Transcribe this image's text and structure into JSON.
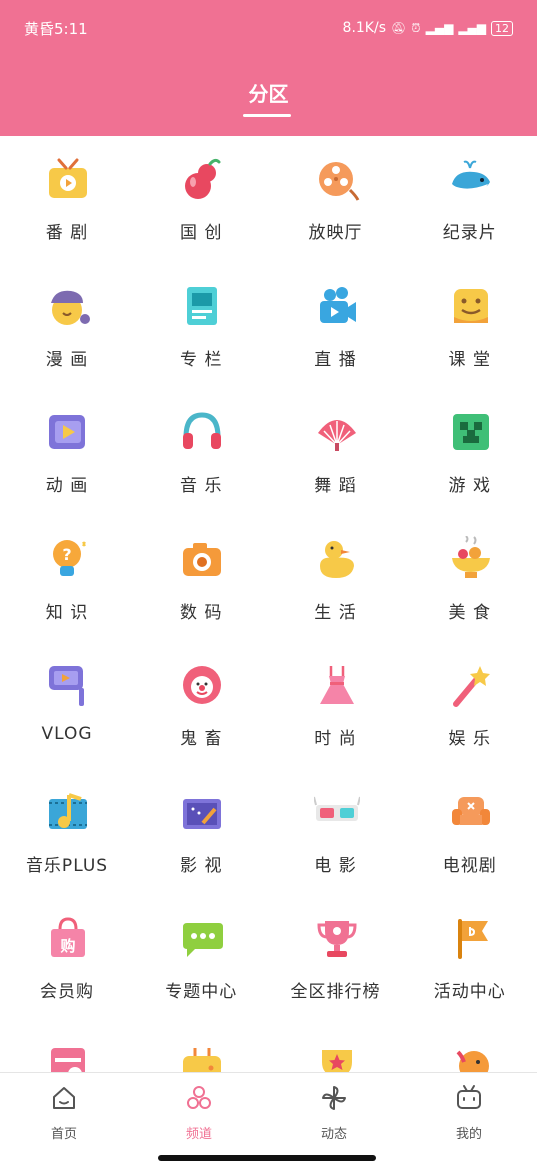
{
  "status_bar": {
    "time": "黄昏5:11",
    "speed": "8.1K/s",
    "battery": "12"
  },
  "header": {
    "title": "分区"
  },
  "categories": [
    {
      "label": "番 剧",
      "icon": "tv-icon"
    },
    {
      "label": "国 创",
      "icon": "gourd-icon"
    },
    {
      "label": "放映厅",
      "icon": "film-reel-icon"
    },
    {
      "label": "纪录片",
      "icon": "whale-icon"
    },
    {
      "label": "漫 画",
      "icon": "beret-character-icon"
    },
    {
      "label": "专 栏",
      "icon": "article-icon"
    },
    {
      "label": "直 播",
      "icon": "video-camera-icon"
    },
    {
      "label": "课 堂",
      "icon": "smiley-card-icon"
    },
    {
      "label": "动 画",
      "icon": "play-square-icon"
    },
    {
      "label": "音 乐",
      "icon": "headphones-icon"
    },
    {
      "label": "舞 蹈",
      "icon": "fan-icon"
    },
    {
      "label": "游 戏",
      "icon": "creeper-icon"
    },
    {
      "label": "知 识",
      "icon": "lightbulb-question-icon"
    },
    {
      "label": "数 码",
      "icon": "camera-icon"
    },
    {
      "label": "生 活",
      "icon": "duck-icon"
    },
    {
      "label": "美 食",
      "icon": "food-bowl-icon"
    },
    {
      "label": "VLOG",
      "icon": "selfie-stick-icon"
    },
    {
      "label": "鬼 畜",
      "icon": "clown-icon"
    },
    {
      "label": "时 尚",
      "icon": "dress-icon"
    },
    {
      "label": "娱 乐",
      "icon": "magic-wand-icon"
    },
    {
      "label": "音乐PLUS",
      "icon": "music-note-icon"
    },
    {
      "label": "影 视",
      "icon": "clapperboard-icon"
    },
    {
      "label": "电 影",
      "icon": "3d-glasses-icon"
    },
    {
      "label": "电视剧",
      "icon": "sofa-icon"
    },
    {
      "label": "会员购",
      "icon": "shopping-bag-icon"
    },
    {
      "label": "专题中心",
      "icon": "chat-bubble-icon"
    },
    {
      "label": "全区排行榜",
      "icon": "trophy-icon"
    },
    {
      "label": "活动中心",
      "icon": "flag-icon"
    },
    {
      "label": "",
      "icon": "calendar-icon"
    },
    {
      "label": "",
      "icon": "gamepad-icon"
    },
    {
      "label": "",
      "icon": "cup-star-icon"
    },
    {
      "label": "",
      "icon": "bird-icon"
    }
  ],
  "tabs": [
    {
      "label": "首页",
      "icon": "home-icon"
    },
    {
      "label": "频道",
      "icon": "channel-icon",
      "active": true
    },
    {
      "label": "动态",
      "icon": "pinwheel-icon"
    },
    {
      "label": "我的",
      "icon": "tv-face-icon"
    }
  ],
  "colors": {
    "brand": "#f07193",
    "text": "#333333"
  }
}
